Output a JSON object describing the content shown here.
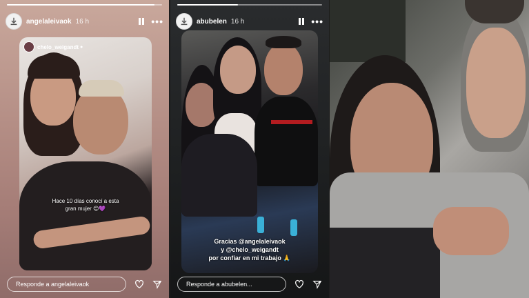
{
  "story1": {
    "username": "angelaleivaok",
    "time": "16 h",
    "mention": "chelo_weigandt",
    "caption_lines": [
      "Hace 10 días conocí a esta",
      "gran mujer 😊💜"
    ],
    "reply_placeholder": "Responde a angelaleivaok",
    "progress": 0.95
  },
  "story2": {
    "username": "abubelen",
    "time": "16 h",
    "caption_lines": [
      "Gracias @angelaleivaok",
      "y @chelo_weigandt",
      "por confiar en mi trabajo 🙏"
    ],
    "reply_placeholder": "Responde a abubelen...",
    "progress": 0.42
  },
  "icons": {
    "download": "download-icon",
    "pause": "pause-icon",
    "more": "more-icon",
    "like": "heart-icon",
    "send": "send-icon"
  },
  "colors": {
    "story1_bg": "#b58f86",
    "story2_bg": "#1d1f20"
  }
}
